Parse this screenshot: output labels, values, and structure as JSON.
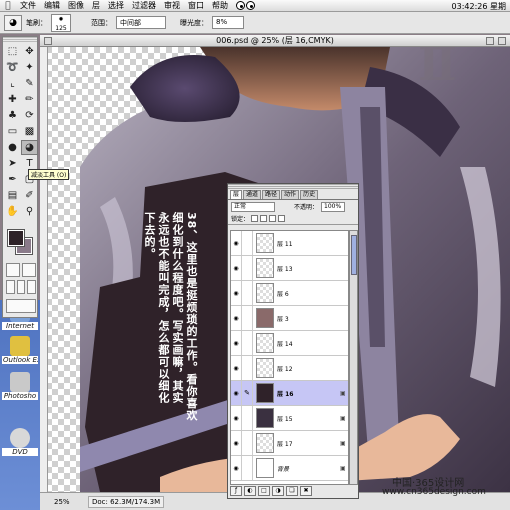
{
  "menubar": {
    "apple": "",
    "items": [
      "文件",
      "编辑",
      "图像",
      "层",
      "选择",
      "过滤器",
      "审视",
      "窗口",
      "帮助"
    ],
    "clock": "03:42:26 星期"
  },
  "options": {
    "brush_label": "笔刷：",
    "brush_size": "125",
    "mode_label": "范围：",
    "mode_value": "中间部",
    "exposure_label": "曝光度：",
    "exposure_value": "8%"
  },
  "document": {
    "title": "006.psd @ 25% (层 16,CMYK)",
    "zoom": "25%",
    "doc_size": "Doc: 62.3M/174.3M"
  },
  "toolbox": {
    "tooltip": "减淡工具 (O)"
  },
  "desktop_icons": [
    {
      "label": "Internet",
      "color": "#7aa0d8"
    },
    {
      "label": "Outlook Ex",
      "color": "#e0c040"
    },
    {
      "label": "Photosho",
      "color": "#c9c9c9"
    },
    {
      "label": "DVD",
      "color": "#d8d8d8"
    }
  ],
  "layers_panel": {
    "tabs": [
      "层",
      "通道",
      "路径",
      "动作",
      "历史"
    ],
    "blend_mode": "正常",
    "opacity_label": "不透明：",
    "opacity_value": "100%",
    "lock_label": "锁定：",
    "layers": [
      {
        "name": "层 11",
        "selected": false,
        "locked": false
      },
      {
        "name": "层 13",
        "selected": false,
        "locked": false
      },
      {
        "name": "层 6",
        "selected": false,
        "locked": false
      },
      {
        "name": "层 3",
        "selected": false,
        "locked": false
      },
      {
        "name": "层 14",
        "selected": false,
        "locked": false
      },
      {
        "name": "层 12",
        "selected": false,
        "locked": false
      },
      {
        "name": "层 16",
        "selected": true,
        "locked": true
      },
      {
        "name": "层 15",
        "selected": false,
        "locked": true
      },
      {
        "name": "层 17",
        "selected": false,
        "locked": true
      },
      {
        "name": "背景",
        "selected": false,
        "locked": true
      }
    ]
  },
  "annotation": {
    "lines": [
      "38、这里也是挺烦琐的工作。看你喜欢",
      "细化到什么程度吧。写实画嘛，其实",
      "永远也不能叫完成，怎么都可以细化",
      "下去的。"
    ]
  },
  "watermark": {
    "line1": "中国·365设计网",
    "line2": "www.cn365design.com"
  },
  "colors": {
    "foreground": "#2e2228",
    "background": "#8a7a8a",
    "jacket": "#5c4f66",
    "skin": "#e8b89a"
  }
}
